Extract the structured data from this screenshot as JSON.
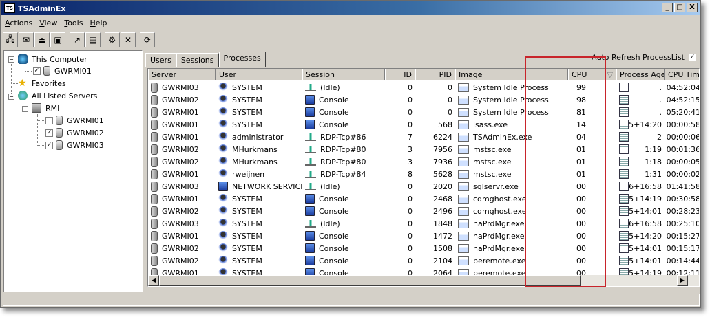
{
  "window": {
    "title": "TSAdminEx",
    "minimize": "_",
    "maximize": "□",
    "close": "X"
  },
  "menu": [
    "Actions",
    "View",
    "Tools",
    "Help"
  ],
  "toolbar": [
    "connect-icon",
    "message-icon",
    "disconnect-icon",
    "reset-icon",
    "remote-control-icon",
    "status-icon",
    "logoff-icon",
    "end-process-icon",
    "refresh-icon"
  ],
  "tree": {
    "this_computer": "This Computer",
    "this_computer_child": "GWRMI01",
    "favorites": "Favorites",
    "all_listed": "All Listed Servers",
    "rmi": "RMI",
    "rmi_children": [
      {
        "label": "GWRMI01",
        "checked": false
      },
      {
        "label": "GWRMI02",
        "checked": true
      },
      {
        "label": "GWRMI03",
        "checked": true
      }
    ]
  },
  "tabs": [
    "Users",
    "Sessions",
    "Processes"
  ],
  "active_tab": "Processes",
  "auto_refresh": {
    "label": "Auto Refresh ProcessList",
    "checked": true
  },
  "columns": [
    "Server",
    "User",
    "Session",
    "ID",
    "PID",
    "Image",
    "CPU",
    "Process Age",
    "CPU Time",
    "V"
  ],
  "sort_indicator": "▽",
  "rows": [
    [
      "GWRMI03",
      "SYSTEM",
      "(Idle)",
      "0",
      "0",
      "System Idle Process",
      "99",
      ".",
      "04:52:04"
    ],
    [
      "GWRMI02",
      "SYSTEM",
      "Console",
      "0",
      "0",
      "System Idle Process",
      "98",
      ".",
      "04:52:15"
    ],
    [
      "GWRMI01",
      "SYSTEM",
      "Console",
      "0",
      "0",
      "System Idle Process",
      "81",
      ".",
      "05:20:41"
    ],
    [
      "GWRMI01",
      "SYSTEM",
      "Console",
      "0",
      "568",
      "lsass.exe",
      "14",
      "5+14:20",
      "00:00:58"
    ],
    [
      "GWRMI01",
      "administrator",
      "RDP-Tcp#86",
      "7",
      "6224",
      "TSAdminEx.exe",
      "04",
      "2",
      "00:00:06"
    ],
    [
      "GWRMI02",
      "MHurkmans",
      "RDP-Tcp#80",
      "3",
      "7956",
      "mstsc.exe",
      "01",
      "1:19",
      "00:01:36"
    ],
    [
      "GWRMI02",
      "MHurkmans",
      "RDP-Tcp#80",
      "3",
      "7936",
      "mstsc.exe",
      "01",
      "1:18",
      "00:00:05"
    ],
    [
      "GWRMI01",
      "rweijnen",
      "RDP-Tcp#84",
      "8",
      "5628",
      "mstsc.exe",
      "01",
      "1:31",
      "00:00:02"
    ],
    [
      "GWRMI03",
      "NETWORK SERVICE",
      "(Idle)",
      "0",
      "2020",
      "sqlservr.exe",
      "00",
      "6+16:58",
      "01:41:58"
    ],
    [
      "GWRMI01",
      "SYSTEM",
      "Console",
      "0",
      "2468",
      "cqmghost.exe",
      "00",
      "5+14:19",
      "00:30:58"
    ],
    [
      "GWRMI02",
      "SYSTEM",
      "Console",
      "0",
      "2496",
      "cqmghost.exe",
      "00",
      "5+14:01",
      "00:28:23"
    ],
    [
      "GWRMI03",
      "SYSTEM",
      "(Idle)",
      "0",
      "1848",
      "naPrdMgr.exe",
      "00",
      "6+16:58",
      "00:25:10"
    ],
    [
      "GWRMI01",
      "SYSTEM",
      "Console",
      "0",
      "1472",
      "naPrdMgr.exe",
      "00",
      "5+14:20",
      "00:15:27"
    ],
    [
      "GWRMI02",
      "SYSTEM",
      "Console",
      "0",
      "1508",
      "naPrdMgr.exe",
      "00",
      "5+14:01",
      "00:15:17"
    ],
    [
      "GWRMI02",
      "SYSTEM",
      "Console",
      "0",
      "2104",
      "beremote.exe",
      "00",
      "5+14:01",
      "00:14:44"
    ],
    [
      "GWRMI01",
      "SYSTEM",
      "Console",
      "0",
      "2064",
      "beremote.exe",
      "00",
      "5+14:19",
      "00:12:11"
    ]
  ],
  "colors": {
    "highlight_box": "#c8242b",
    "title_start": "#0a246a",
    "title_end": "#a6caf0"
  }
}
